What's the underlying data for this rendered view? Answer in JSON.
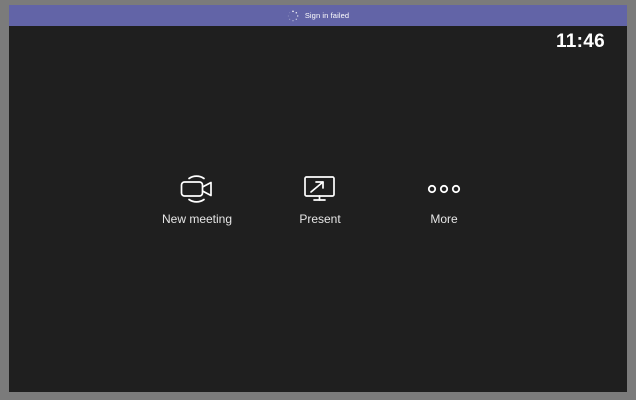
{
  "status_banner": {
    "text": "Sign in failed",
    "color": "#6264a7",
    "icon": "spinner-icon"
  },
  "clock": {
    "time": "11:46"
  },
  "actions": [
    {
      "label": "New meeting",
      "icon": "video-camera-icon"
    },
    {
      "label": "Present",
      "icon": "screen-share-icon"
    },
    {
      "label": "More",
      "icon": "more-dots-icon"
    }
  ],
  "colors": {
    "background": "#1f1f1f",
    "bezel": "#7b7b7b",
    "text": "#ffffff"
  }
}
